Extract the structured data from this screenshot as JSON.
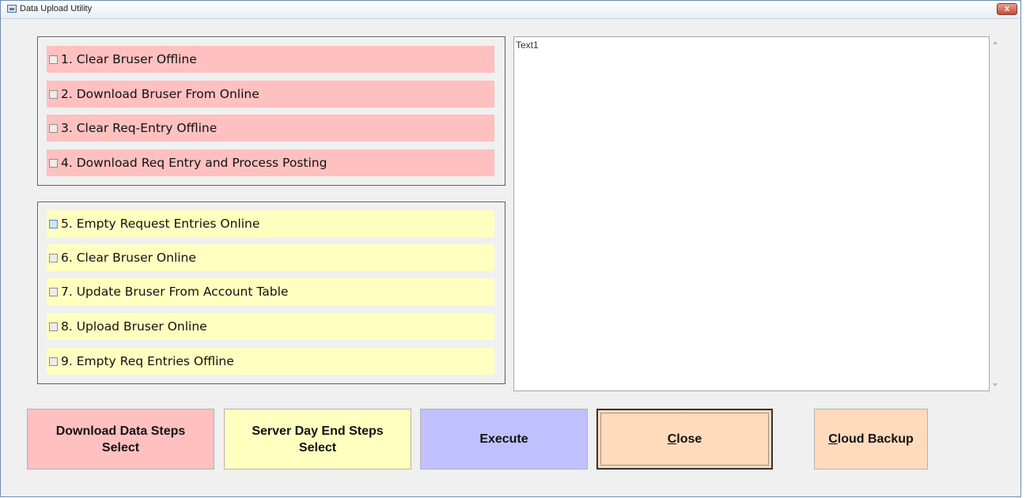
{
  "window": {
    "title": "Data Upload Utility",
    "close_glyph": "x"
  },
  "download_steps": [
    {
      "label": "1. Clear Bruser Offline",
      "checked": false
    },
    {
      "label": "2. Download Bruser From Online",
      "checked": false
    },
    {
      "label": "3. Clear Req-Entry Offline",
      "checked": false
    },
    {
      "label": "4. Download Req Entry and Process Posting",
      "checked": false
    }
  ],
  "server_steps": [
    {
      "label": "5. Empty Request Entries Online",
      "checked": false
    },
    {
      "label": "6. Clear Bruser Online",
      "checked": false
    },
    {
      "label": "7. Update Bruser From Account Table",
      "checked": false
    },
    {
      "label": "8. Upload Bruser Online",
      "checked": false
    },
    {
      "label": "9. Empty Req Entries Offline",
      "checked": false
    }
  ],
  "log": {
    "text": "Text1"
  },
  "buttons": {
    "download_line1": "Download Data Steps",
    "download_line2": "Select",
    "server_line1": "Server Day End Steps",
    "server_line2": "Select",
    "execute": "Execute",
    "close_mnemonic": "C",
    "close_rest": "lose",
    "cloud_mnemonic": "C",
    "cloud_rest": "loud Backup"
  },
  "colors": {
    "download_group": "#ffc0c0",
    "server_group": "#ffffc0",
    "execute_button": "#c0c0ff",
    "close_button": "#ffdbbc"
  }
}
